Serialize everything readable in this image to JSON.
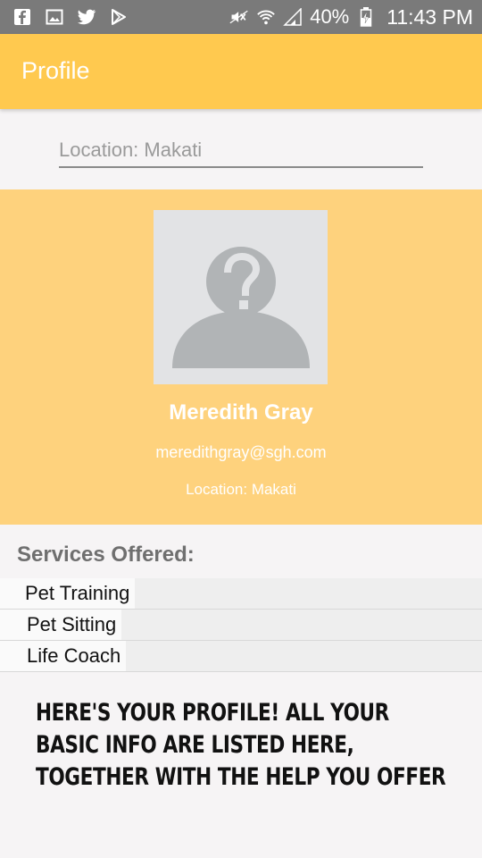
{
  "status_bar": {
    "left_icons": [
      "facebook-icon",
      "gallery-icon",
      "twitter-icon",
      "play-store-icon"
    ],
    "right_icons": [
      "mute-icon",
      "wifi-icon",
      "signal-icon",
      "battery-charging-icon"
    ],
    "battery": "40%",
    "time": "11:43 PM"
  },
  "app_bar": {
    "title": "Profile"
  },
  "location_field": {
    "value": "Location: Makati"
  },
  "profile": {
    "avatar_icon": "unknown-user-icon",
    "name": "Meredith Gray",
    "email": "meredithgray@sgh.com",
    "location": "Location: Makati"
  },
  "services": {
    "heading": "Services Offered:",
    "items": [
      "Pet Training",
      "Pet Sitting",
      "Life Coach"
    ]
  },
  "caption": {
    "line1": "HERE'S YOUR PROFILE! ALL YOUR",
    "line2": "BASIC INFO ARE LISTED HERE,",
    "line3": "TOGETHER WITH THE HELP YOU OFFER"
  },
  "colors": {
    "status_bar": "#7a7a7a",
    "app_bar": "#ffc94f",
    "profile_card": "#fed27d",
    "background": "#f6f4f5"
  }
}
